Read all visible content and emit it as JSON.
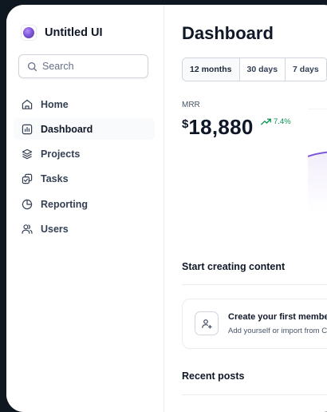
{
  "app": {
    "name": "Untitled UI"
  },
  "search": {
    "placeholder": "Search"
  },
  "nav": {
    "items": [
      {
        "label": "Home",
        "icon": "home-icon",
        "active": false
      },
      {
        "label": "Dashboard",
        "icon": "bar-chart-icon",
        "active": true
      },
      {
        "label": "Projects",
        "icon": "layers-icon",
        "active": false
      },
      {
        "label": "Tasks",
        "icon": "check-square-icon",
        "active": false
      },
      {
        "label": "Reporting",
        "icon": "pie-chart-icon",
        "active": false
      },
      {
        "label": "Users",
        "icon": "users-icon",
        "active": false
      }
    ]
  },
  "main": {
    "title": "Dashboard",
    "tabs": [
      {
        "label": "12 months",
        "active": true
      },
      {
        "label": "30 days",
        "active": false
      },
      {
        "label": "7 days",
        "active": false
      }
    ],
    "metric": {
      "label": "MRR",
      "currency": "$",
      "value": "18,880",
      "change": "7.4%",
      "change_icon": "trend-up-icon"
    },
    "create_section": {
      "title": "Start creating content",
      "card": {
        "icon": "user-plus-icon",
        "title": "Create your first member",
        "subtitle": "Add yourself or import from CSV"
      }
    },
    "recent_posts": {
      "title": "Recent posts"
    }
  },
  "colors": {
    "accent": "#7f56d9",
    "positive": "#079455",
    "text_primary": "#101828",
    "border": "#d0d5dd",
    "background": "#0f1720"
  }
}
